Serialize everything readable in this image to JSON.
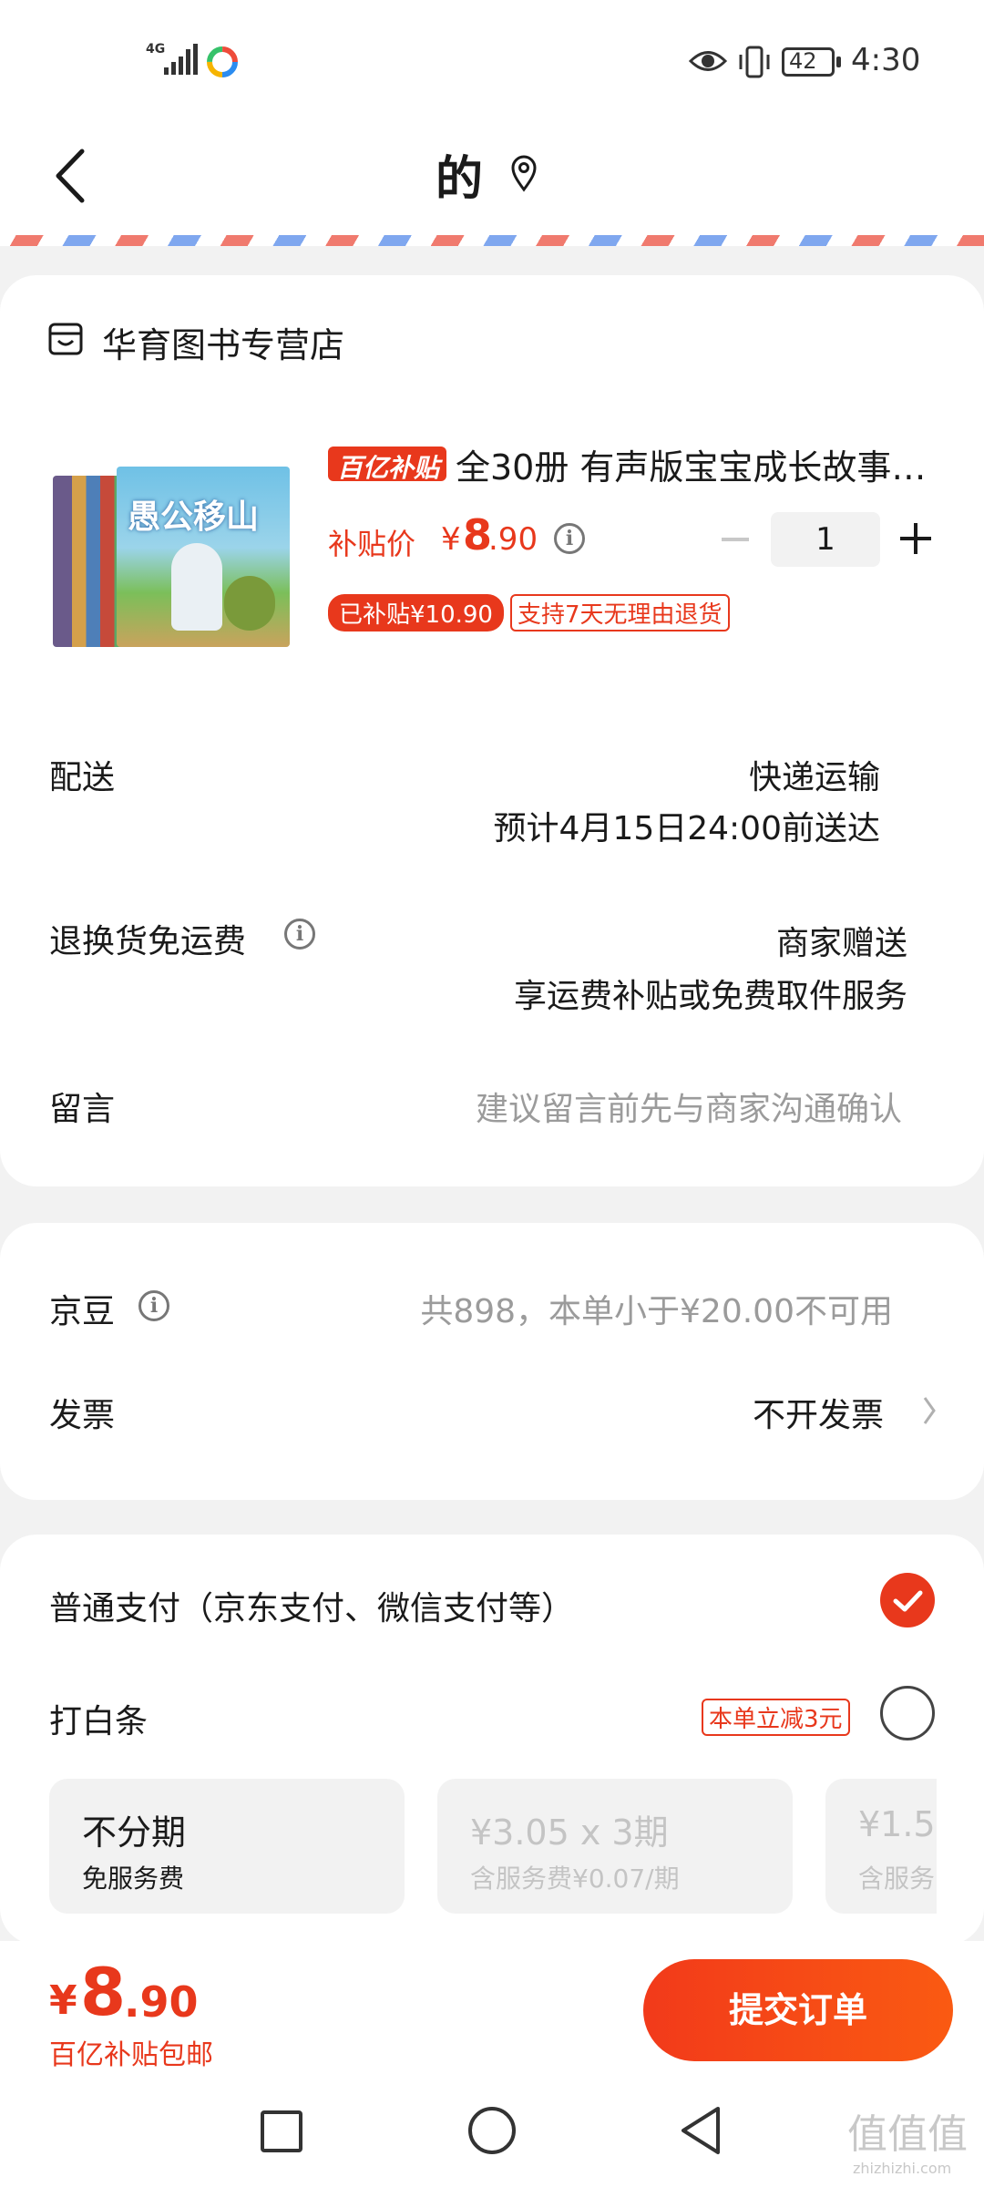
{
  "status_bar": {
    "network": "4G",
    "battery": "42",
    "time": "4:30"
  },
  "header": {
    "title": "的"
  },
  "store": {
    "name": "华育图书专营店"
  },
  "product": {
    "badge": "百亿补贴",
    "title": "全30册 有声版宝宝成长故事…",
    "cover_text": "愚公移山",
    "price_label": "补贴价",
    "currency": "¥",
    "price_int": "8",
    "price_dec": ".90",
    "quantity": "1",
    "subsidy_tag": "已补贴¥10.90",
    "return_tag": "支持7天无理由退货"
  },
  "delivery": {
    "label": "配送",
    "method": "快递运输",
    "eta": "预计4月15日24:00前送达"
  },
  "return_shipping": {
    "label": "退换货免运费",
    "value": "商家赠送",
    "desc": "享运费补贴或免费取件服务"
  },
  "message": {
    "label": "留言",
    "placeholder": "建议留言前先与商家沟通确认"
  },
  "beans": {
    "label": "京豆",
    "value": "共898，本单小于¥20.00不可用"
  },
  "invoice": {
    "label": "发票",
    "value": "不开发票"
  },
  "payment": {
    "normal_label": "普通支付（京东支付、微信支付等）",
    "baitiao_label": "打白条",
    "baitiao_promo": "本单立减3元",
    "plans": [
      {
        "title": "不分期",
        "sub": "免服务费"
      },
      {
        "title": "¥3.05 x 3期",
        "sub": "含服务费¥0.07/期"
      },
      {
        "title": "¥1.5",
        "sub": "含服务"
      }
    ]
  },
  "footer": {
    "currency": "¥",
    "price_int": "8",
    "price_dec": ".90",
    "note": "百亿补贴包邮",
    "submit_label": "提交订单"
  },
  "watermark": {
    "text": "值值值",
    "url": "zhizhizhi.com"
  },
  "colors": {
    "accent": "#e8381c",
    "submit_gradient": [
      "#f23a1a",
      "#fa5a12"
    ]
  }
}
